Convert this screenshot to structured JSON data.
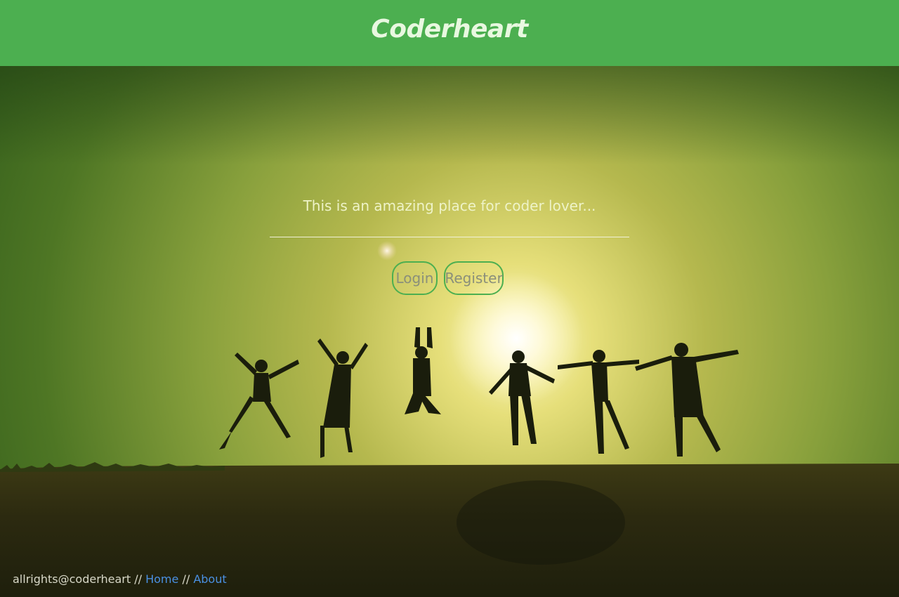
{
  "header": {
    "brand": "Coderheart"
  },
  "hero": {
    "tagline": "This is an amazing place for coder lover...",
    "login_label": "Login",
    "register_label": "Register"
  },
  "footer": {
    "copyright": "allrights@coderheart",
    "separator_1": " // ",
    "home_link": "Home",
    "separator_2": " // ",
    "about_link": "About"
  },
  "colors": {
    "header_bg": "#4caf50",
    "link": "#4a90e2"
  }
}
